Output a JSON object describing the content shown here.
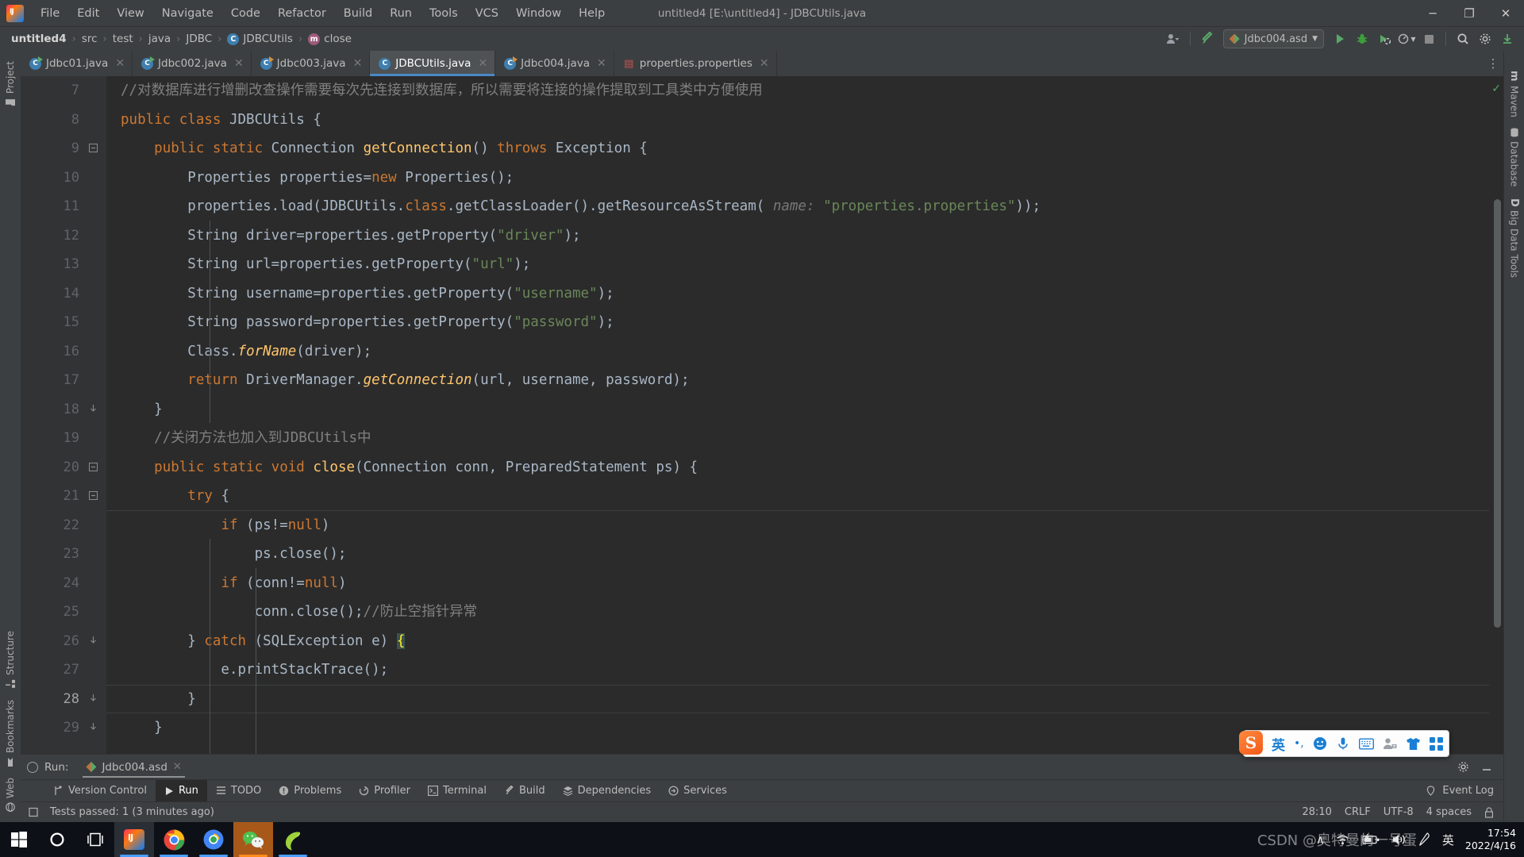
{
  "titlebar": {
    "window_title": "untitled4 [E:\\untitled4] - JDBCUtils.java",
    "logo_text": "IJ",
    "menus": [
      "File",
      "Edit",
      "View",
      "Navigate",
      "Code",
      "Refactor",
      "Build",
      "Run",
      "Tools",
      "VCS",
      "Window",
      "Help"
    ],
    "minimize": "─",
    "maximize": "❐",
    "close": "✕"
  },
  "breadcrumb": {
    "items": [
      {
        "label": "untitled4",
        "icon": ""
      },
      {
        "label": "src",
        "icon": ""
      },
      {
        "label": "test",
        "icon": ""
      },
      {
        "label": "java",
        "icon": ""
      },
      {
        "label": "JDBC",
        "icon": ""
      },
      {
        "label": "JDBCUtils",
        "icon": "class-icon"
      },
      {
        "label": "close",
        "icon": "method-icon"
      }
    ],
    "separator": "›"
  },
  "toolbar": {
    "run_config": "Jdbc004.asd",
    "user_icon": "user-icon",
    "hammer_icon": "build-icon",
    "run_icon": "run-icon",
    "debug_icon": "debug-icon",
    "coverage_icon": "run-coverage-icon",
    "profile_icon": "profile-icon",
    "stop_icon": "stop-icon",
    "search_icon": "search-icon",
    "settings_icon": "gear-icon",
    "update_icon": "update-icon"
  },
  "editor_tabs": [
    {
      "label": "Jdbc01.java",
      "icon": "java-class-icon",
      "active": false
    },
    {
      "label": "Jdbc002.java",
      "icon": "java-class-icon",
      "active": false
    },
    {
      "label": "Jdbc003.java",
      "icon": "java-class-icon",
      "active": false
    },
    {
      "label": "JDBCUtils.java",
      "icon": "java-class-icon",
      "active": true
    },
    {
      "label": "Jdbc004.java",
      "icon": "java-class-icon",
      "active": false
    },
    {
      "label": "properties.properties",
      "icon": "properties-file-icon",
      "active": false
    }
  ],
  "tabs_overflow_icon": "more-vertical-icon",
  "left_toolwindows": [
    {
      "label": "Project",
      "icon": "folder-icon"
    },
    {
      "label": "Structure",
      "icon": "structure-icon"
    },
    {
      "label": "Bookmarks",
      "icon": "bookmark-icon"
    },
    {
      "label": "Web",
      "icon": "web-icon"
    }
  ],
  "right_toolwindows": [
    {
      "label": "Maven",
      "icon": "maven-icon"
    },
    {
      "label": "Database",
      "icon": "database-icon"
    },
    {
      "label": "Big Data Tools",
      "icon": "bigdata-icon"
    }
  ],
  "editor": {
    "first_line": 7,
    "current_line": 28,
    "lines": [
      {
        "n": 7,
        "fold": "",
        "indent": 0
      },
      {
        "n": 8,
        "fold": "",
        "indent": 0
      },
      {
        "n": 9,
        "fold": "minus",
        "indent": 0
      },
      {
        "n": 10,
        "fold": "",
        "indent": 0
      },
      {
        "n": 11,
        "fold": "",
        "indent": 0
      },
      {
        "n": 12,
        "fold": "",
        "indent": 0
      },
      {
        "n": 13,
        "fold": "",
        "indent": 0
      },
      {
        "n": 14,
        "fold": "",
        "indent": 0
      },
      {
        "n": 15,
        "fold": "",
        "indent": 0
      },
      {
        "n": 16,
        "fold": "",
        "indent": 0
      },
      {
        "n": 17,
        "fold": "",
        "indent": 0
      },
      {
        "n": 18,
        "fold": "end",
        "indent": 0
      },
      {
        "n": 19,
        "fold": "",
        "indent": 0
      },
      {
        "n": 20,
        "fold": "minus",
        "indent": 0
      },
      {
        "n": 21,
        "fold": "minus",
        "indent": 0
      },
      {
        "n": 22,
        "fold": "",
        "indent": 0
      },
      {
        "n": 23,
        "fold": "",
        "indent": 0
      },
      {
        "n": 24,
        "fold": "",
        "indent": 0
      },
      {
        "n": 25,
        "fold": "",
        "indent": 0
      },
      {
        "n": 26,
        "fold": "end",
        "indent": 0
      },
      {
        "n": 27,
        "fold": "",
        "indent": 0
      },
      {
        "n": 28,
        "fold": "end",
        "indent": 0
      },
      {
        "n": 29,
        "fold": "end",
        "indent": 0
      }
    ],
    "source_text": [
      "//对数据库进行增删改查操作需要每次先连接到数据库，所以需要将连接的操作提取到工具类中方便使用",
      "public class JDBCUtils {",
      "    public static Connection getConnection() throws Exception {",
      "        Properties properties=new Properties();",
      "        properties.load(JDBCUtils.class.getClassLoader().getResourceAsStream( name: \"properties.properties\"));",
      "        String driver=properties.getProperty(\"driver\");",
      "        String url=properties.getProperty(\"url\");",
      "        String username=properties.getProperty(\"username\");",
      "        String password=properties.getProperty(\"password\");",
      "        Class.forName(driver);",
      "        return DriverManager.getConnection(url, username, password);",
      "    }",
      "    //关闭方法也加入到JDBCUtils中",
      "    public static void close(Connection conn, PreparedStatement ps) {",
      "        try {",
      "            if (ps!=null)",
      "                ps.close();",
      "            if (conn!=null)",
      "                conn.close();//防止空指针异常",
      "        } catch (SQLException e) {",
      "            e.printStackTrace();",
      "        }",
      "    }"
    ],
    "inlay_hint": "name:"
  },
  "run_panel": {
    "label": "Run:",
    "tab_label": "Jdbc004.asd",
    "close_icon": "close-icon",
    "settings_icon": "gear-icon",
    "minimize_icon": "minimize-icon"
  },
  "bottom_tabs": [
    {
      "label": "Version Control",
      "icon": "branch-icon",
      "active": false
    },
    {
      "label": "Run",
      "icon": "run-icon",
      "active": true
    },
    {
      "label": "TODO",
      "icon": "todo-icon",
      "active": false
    },
    {
      "label": "Problems",
      "icon": "problems-icon",
      "active": false
    },
    {
      "label": "Profiler",
      "icon": "profiler-icon",
      "active": false
    },
    {
      "label": "Terminal",
      "icon": "terminal-icon",
      "active": false
    },
    {
      "label": "Build",
      "icon": "build-icon",
      "active": false
    },
    {
      "label": "Dependencies",
      "icon": "dependencies-icon",
      "active": false
    },
    {
      "label": "Services",
      "icon": "services-icon",
      "active": false
    }
  ],
  "event_log": {
    "label": "Event Log",
    "icon": "event-log-icon"
  },
  "status_bar": {
    "message": "Tests passed: 1 (3 minutes ago)",
    "caret": "28:10",
    "line_sep": "CRLF",
    "encoding": "UTF-8",
    "indent": "4 spaces",
    "lock_icon": "lock-icon"
  },
  "ime_bar": {
    "logo": "S",
    "mode": "英",
    "punct": "•,",
    "emoji_icon": "emoji-icon",
    "mic_icon": "microphone-icon",
    "keyboard_icon": "keyboard-icon",
    "user_icon": "user-account-icon",
    "skin_icon": "skin-shirt-icon",
    "apps_icon": "app-grid-icon"
  },
  "taskbar": {
    "items": [
      {
        "name": "start-button",
        "icon": "windows-logo",
        "accent": ""
      },
      {
        "name": "cortana-search",
        "icon": "circle-icon",
        "accent": ""
      },
      {
        "name": "task-view",
        "icon": "task-view-icon",
        "accent": ""
      },
      {
        "name": "intellij-idea",
        "icon": "intellij-icon",
        "accent": "#4a9eff"
      },
      {
        "name": "google-chrome",
        "icon": "chrome-icon",
        "accent": "#4a9eff"
      },
      {
        "name": "chrome-beta",
        "icon": "chrome-beta-icon",
        "accent": "#4a9eff"
      },
      {
        "name": "wechat",
        "icon": "wechat-icon",
        "accent": "#ff8c1a"
      },
      {
        "name": "navicat",
        "icon": "navicat-icon",
        "accent": "#4a9eff"
      }
    ],
    "tray": {
      "chevron": "∧",
      "wifi_icon": "wifi-icon",
      "battery_icon": "battery-charging-icon",
      "volume_icon": "volume-icon",
      "pen_icon": "pen-icon",
      "ime_label": "英"
    },
    "clock": {
      "time": "17:54",
      "date": "2022/4/16"
    },
    "watermark": "CSDN @奥特曼的一号蛋"
  }
}
